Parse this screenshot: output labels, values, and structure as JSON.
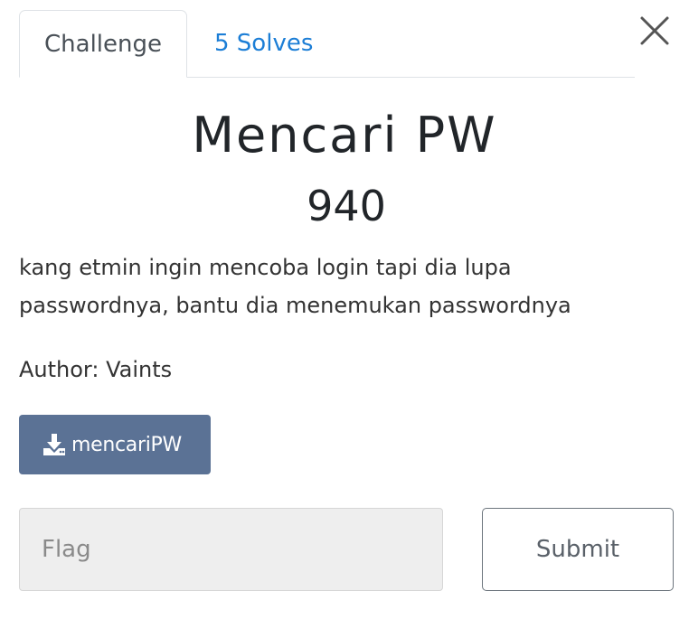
{
  "tabs": [
    {
      "label": "Challenge",
      "active": true
    },
    {
      "label": "5 Solves",
      "active": false
    }
  ],
  "close": {
    "icon": "close-icon"
  },
  "challenge": {
    "title": "Mencari PW",
    "value": "940",
    "description": "kang etmin ingin mencoba login tapi dia lupa passwordnya, bantu dia menemukan passwordnya",
    "author": "Author: Vaints"
  },
  "file": {
    "icon": "download-icon",
    "label": "mencariPW"
  },
  "flag": {
    "placeholder": "Flag",
    "value": ""
  },
  "submit": {
    "label": "Submit"
  },
  "colors": {
    "tab_link": "#1c7ed6",
    "download_button": "#5b7295",
    "input_background": "#eeeeee"
  }
}
